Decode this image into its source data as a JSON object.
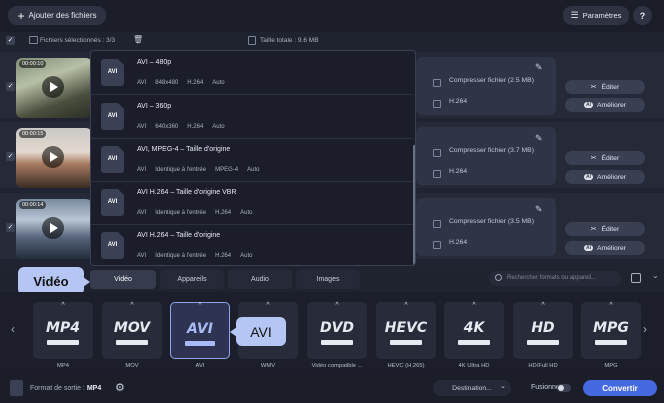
{
  "toolbar": {
    "add_files": "Ajouter des fichiers",
    "settings": "Paramètres",
    "help": "?"
  },
  "selection": {
    "selected": "Fichiers sélectionnés : 3/3",
    "total": "Taille totale : 9.6 MB"
  },
  "files": [
    {
      "duration": "00:00:10",
      "compress": "Compresser fichier (2.5 MB)",
      "codec": "H.264"
    },
    {
      "duration": "00:00:15",
      "compress": "Compresser fichier (3.7 MB)",
      "codec": "H.264"
    },
    {
      "duration": "00:00:14",
      "compress": "Compresser fichier (3.5 MB)",
      "codec": "H.264"
    }
  ],
  "row_buttons": {
    "edit": "Éditer",
    "enhance": "Améliorer",
    "ai_badge": "AI"
  },
  "presets": [
    {
      "icon": "AVI",
      "title": "AVI – 480p",
      "details": [
        "AVI",
        "848x480",
        "H.264",
        "Auto"
      ]
    },
    {
      "icon": "AVI",
      "title": "AVI – 360p",
      "details": [
        "AVI",
        "640x360",
        "H.264",
        "Auto"
      ]
    },
    {
      "icon": "AVI",
      "title": "AVI, MPEG-4 – Taille d'origine",
      "details": [
        "AVI",
        "Identique à l'entrée",
        "MPEG-4",
        "Auto"
      ]
    },
    {
      "icon": "AVI",
      "title": "AVI H.264 – Taille d'origine VBR",
      "details": [
        "AVI",
        "Identique à l'entrée",
        "H.264",
        "Auto"
      ]
    },
    {
      "icon": "AVI",
      "title": "AVI H.264 – Taille d'origine",
      "details": [
        "AVI",
        "Identique à l'entrée",
        "H.264",
        "Auto"
      ]
    }
  ],
  "callouts": {
    "video": "Vidéo",
    "avi": "AVI"
  },
  "tabs": [
    "Vidéo",
    "Appareils",
    "Audio",
    "Images"
  ],
  "search_placeholder": "Rechercher formats ou appareil...",
  "formats": [
    {
      "logo": "MP4",
      "name": "MP4"
    },
    {
      "logo": "MOV",
      "name": "MOV"
    },
    {
      "logo": "AVI",
      "name": "AVI"
    },
    {
      "logo": "WMV",
      "name": "WMV"
    },
    {
      "logo": "DVD",
      "name": "Vidéo compatible ..."
    },
    {
      "logo": "HEVC",
      "name": "HEVC (H.265)"
    },
    {
      "logo": "4K",
      "name": "4K Ultra HD"
    },
    {
      "logo": "HD",
      "name": "HD/Full HD"
    },
    {
      "logo": "MPG",
      "name": "MPG"
    }
  ],
  "bottom": {
    "output_label": "Format de sortie :",
    "output_value": "MP4",
    "destination": "Destination...",
    "merge": "Fusionner :",
    "convert": "Convertir"
  },
  "colors": {
    "accent": "#4469e0",
    "callout": "#b6c6f4",
    "background": "#202432"
  }
}
